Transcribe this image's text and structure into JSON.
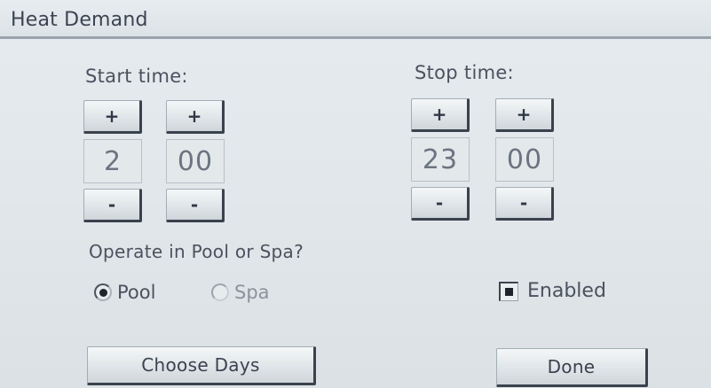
{
  "title": "Heat Demand",
  "start": {
    "label": "Start time:",
    "hour": "2",
    "minute": "00"
  },
  "stop": {
    "label": "Stop time:",
    "hour": "23",
    "minute": "00"
  },
  "stepper": {
    "plus": "+",
    "minus": "-"
  },
  "operate": {
    "question": "Operate in Pool or Spa?",
    "pool_label": "Pool",
    "spa_label": "Spa",
    "selected": "Pool"
  },
  "enabled": {
    "label": "Enabled",
    "checked": true
  },
  "actions": {
    "choose_days": "Choose Days",
    "done": "Done"
  },
  "colors": {
    "background": "#e1e7ea",
    "button_shadow": "#39424d",
    "text": "#4a5260"
  }
}
